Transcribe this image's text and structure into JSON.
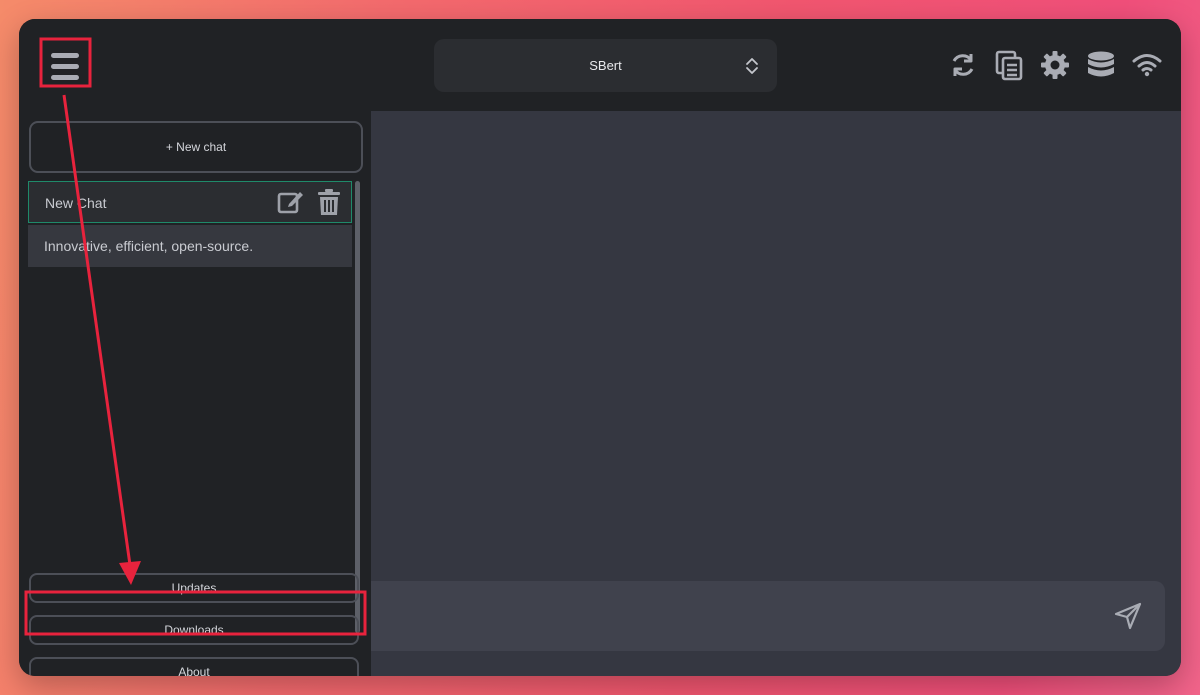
{
  "header": {
    "menu_icon": "hamburger-menu-icon",
    "model_select": {
      "value": "SBert",
      "icon": "up-down-chevron-icon"
    },
    "actions": [
      {
        "name": "refresh-icon"
      },
      {
        "name": "copy-icon"
      },
      {
        "name": "settings-gear-icon"
      },
      {
        "name": "database-icon"
      },
      {
        "name": "wifi-icon"
      }
    ]
  },
  "sidebar": {
    "new_chat_label": "+ New chat",
    "chats": [
      {
        "title": "New Chat",
        "active": true
      },
      {
        "title": "Innovative, efficient, open-source.",
        "active": false
      }
    ],
    "buttons": {
      "updates": "Updates",
      "downloads": "Downloads",
      "about": "About"
    }
  },
  "main": {
    "send_icon": "send-icon"
  },
  "annotation_color": "#e8233d",
  "colors": {
    "window_bg": "#202225",
    "main_bg": "#353741",
    "accent_green": "#1f8a6a"
  }
}
